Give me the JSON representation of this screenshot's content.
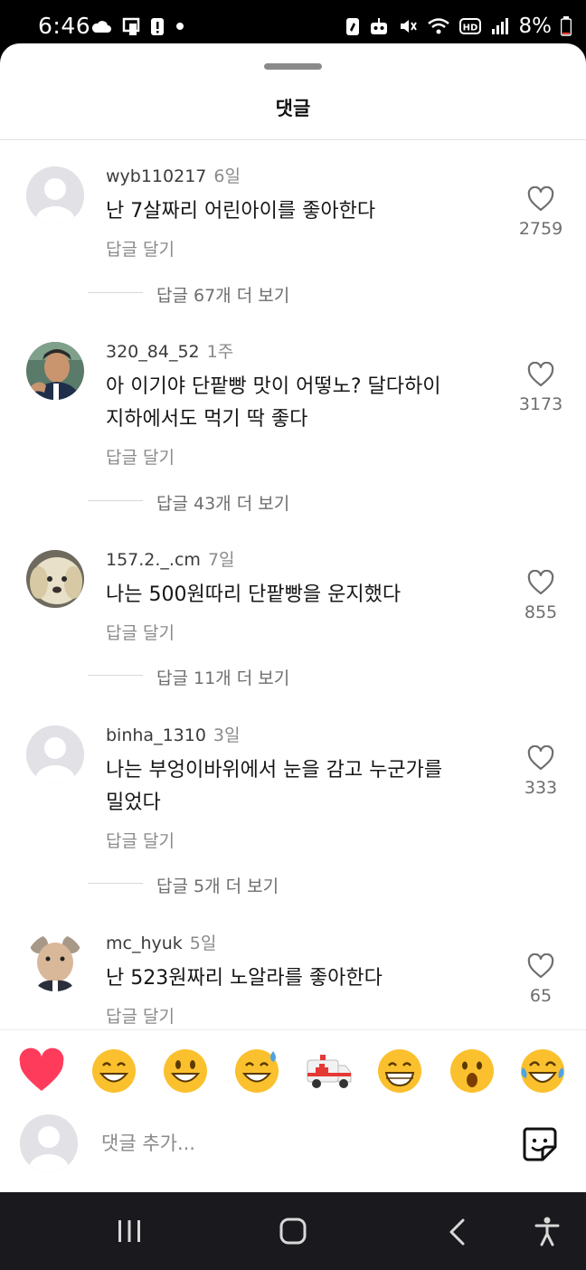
{
  "status": {
    "time": "6:46",
    "battery": "8%",
    "left_icons": [
      "cloud-icon",
      "cast-icon",
      "alert-icon",
      "dot-icon"
    ],
    "right_icons": [
      "nfc-icon",
      "bot-icon",
      "mute-icon",
      "wifi-icon",
      "hd-icon",
      "signal-icon",
      "battery-icon"
    ]
  },
  "sheet": {
    "title": "댓글"
  },
  "comments": [
    {
      "user": "wyb110217",
      "time": "6일",
      "lines": [
        "난 7살짜리 어린아이를 좋아한다"
      ],
      "reply": "답글 달기",
      "likes": "2759",
      "more": "답글 67개 더 보기",
      "avatar": "default-avatar"
    },
    {
      "user": "320_84_52",
      "time": "1주",
      "lines": [
        "아 이기야 단팥빵 맛이 어떻노? 달다하이",
        "지하에서도 먹기 딱 좋다"
      ],
      "reply": "답글 달기",
      "likes": "3173",
      "more": "답글 43개 더 보기",
      "avatar": "photo-avatar-man"
    },
    {
      "user": "157.2._.cm",
      "time": "7일",
      "lines": [
        "나는 500원따리 단팥빵을 운지했다"
      ],
      "reply": "답글 달기",
      "likes": "855",
      "more": "답글 11개 더 보기",
      "avatar": "photo-avatar-dog"
    },
    {
      "user": "binha_1310",
      "time": "3일",
      "lines": [
        "나는 부엉이바위에서 눈을 감고 누군가를",
        "밀었다"
      ],
      "reply": "답글 달기",
      "likes": "333",
      "more": "답글 5개 더 보기",
      "avatar": "default-avatar"
    },
    {
      "user": "mc_hyuk",
      "time": "5일",
      "lines": [
        "난 523원짜리 노알라를 좋아한다"
      ],
      "reply": "답글 달기",
      "likes": "65",
      "more": "",
      "avatar": "photo-avatar-koala"
    }
  ],
  "emoji_bar": [
    "heart",
    "grin",
    "smiley",
    "sweat-smile",
    "ambulance",
    "beaming",
    "surprised",
    "joy"
  ],
  "input": {
    "placeholder": "댓글 추가..."
  },
  "nav": [
    "recents-icon",
    "home-icon",
    "back-icon",
    "accessibility-icon"
  ],
  "colors": {
    "sheet_bg": "#ffffff",
    "nav_bg": "#1a1a1e",
    "heart": "#ff3b5c",
    "emoji_yellow": "#fbc02d"
  }
}
